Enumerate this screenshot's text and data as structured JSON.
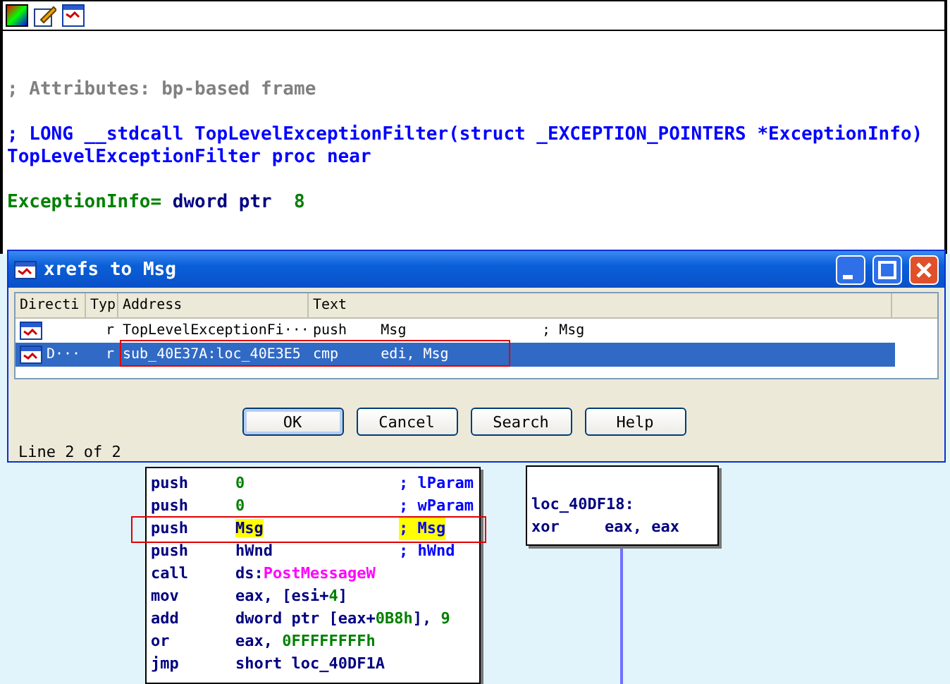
{
  "listing": {
    "blocks": [
      [
        {
          "parts": [
            {
              "kind": "comment",
              "text": "; Attributes: bp-based frame"
            }
          ]
        }
      ],
      [
        {
          "parts": [
            {
              "kind": "decl",
              "text": "; LONG __stdcall TopLevelExceptionFilter(struct _EXCEPTION_POINTERS *ExceptionInfo)"
            }
          ]
        },
        {
          "parts": [
            {
              "kind": "decl",
              "text": "TopLevelExceptionFilter proc near"
            }
          ]
        }
      ],
      [
        {
          "parts": [
            {
              "kind": "var",
              "text": "ExceptionInfo="
            },
            {
              "kind": "op",
              "text": " dword ptr  "
            },
            {
              "kind": "num",
              "text": "8"
            }
          ]
        }
      ]
    ]
  },
  "graph": {
    "nodes": [
      {
        "kind": "code",
        "rows": [
          {
            "mnemonic": "push",
            "operand": [
              {
                "kind": "num",
                "text": "0"
              }
            ],
            "comment": "; lParam",
            "marked": false
          },
          {
            "mnemonic": "push",
            "operand": [
              {
                "kind": "num",
                "text": "0"
              }
            ],
            "comment": "; wParam",
            "marked": false
          },
          {
            "mnemonic": "push",
            "operand": [
              {
                "kind": "op",
                "text": "Msg",
                "highlight": true
              }
            ],
            "comment": "; Msg",
            "comment_highlight": true,
            "marked": true
          },
          {
            "mnemonic": "push",
            "operand": [
              {
                "kind": "op",
                "text": "hWnd"
              }
            ],
            "comment": "; hWnd",
            "marked": false
          },
          {
            "mnemonic": "call",
            "operand": [
              {
                "kind": "op",
                "text": "ds:"
              },
              {
                "kind": "import",
                "text": "PostMessageW"
              }
            ],
            "marked": false
          },
          {
            "mnemonic": "mov",
            "operand": [
              {
                "kind": "op",
                "text": "eax, [esi+"
              },
              {
                "kind": "num",
                "text": "4"
              },
              {
                "kind": "op",
                "text": "]"
              }
            ],
            "marked": false
          },
          {
            "mnemonic": "add",
            "operand": [
              {
                "kind": "op",
                "text": "dword ptr [eax+"
              },
              {
                "kind": "num",
                "text": "0B8h"
              },
              {
                "kind": "op",
                "text": "], "
              },
              {
                "kind": "num",
                "text": "9"
              }
            ],
            "marked": false
          },
          {
            "mnemonic": "or",
            "operand": [
              {
                "kind": "op",
                "text": "eax, "
              },
              {
                "kind": "num",
                "text": "0FFFFFFFFh"
              }
            ],
            "marked": false
          },
          {
            "mnemonic": "jmp",
            "operand": [
              {
                "kind": "op",
                "text": "short loc_40DF1A"
              }
            ],
            "marked": false
          }
        ]
      },
      {
        "kind": "label",
        "label": "loc_40DF18:",
        "rows": [
          {
            "mnemonic": "xor",
            "operand": [
              {
                "kind": "op",
                "text": "eax, eax"
              }
            ],
            "marked": false
          }
        ]
      }
    ]
  },
  "dialog": {
    "title": "xrefs to Msg",
    "columns": [
      "Directi",
      "Typ",
      "Address",
      "Text"
    ],
    "rows": [
      {
        "direction": "",
        "type": "r",
        "address": "TopLevelExceptionFi···",
        "text": "push    Msg                ; Msg",
        "selected": false,
        "marked": false
      },
      {
        "direction": "D···",
        "type": "r",
        "address": "sub_40E37A:loc_40E3E5",
        "text": "cmp     edi, Msg",
        "selected": true,
        "marked": true
      }
    ],
    "buttons": [
      {
        "label": "OK",
        "default": true
      },
      {
        "label": "Cancel",
        "default": false
      },
      {
        "label": "Search",
        "default": false
      },
      {
        "label": "Help",
        "default": false
      }
    ],
    "status": "Line 2 of 2"
  }
}
